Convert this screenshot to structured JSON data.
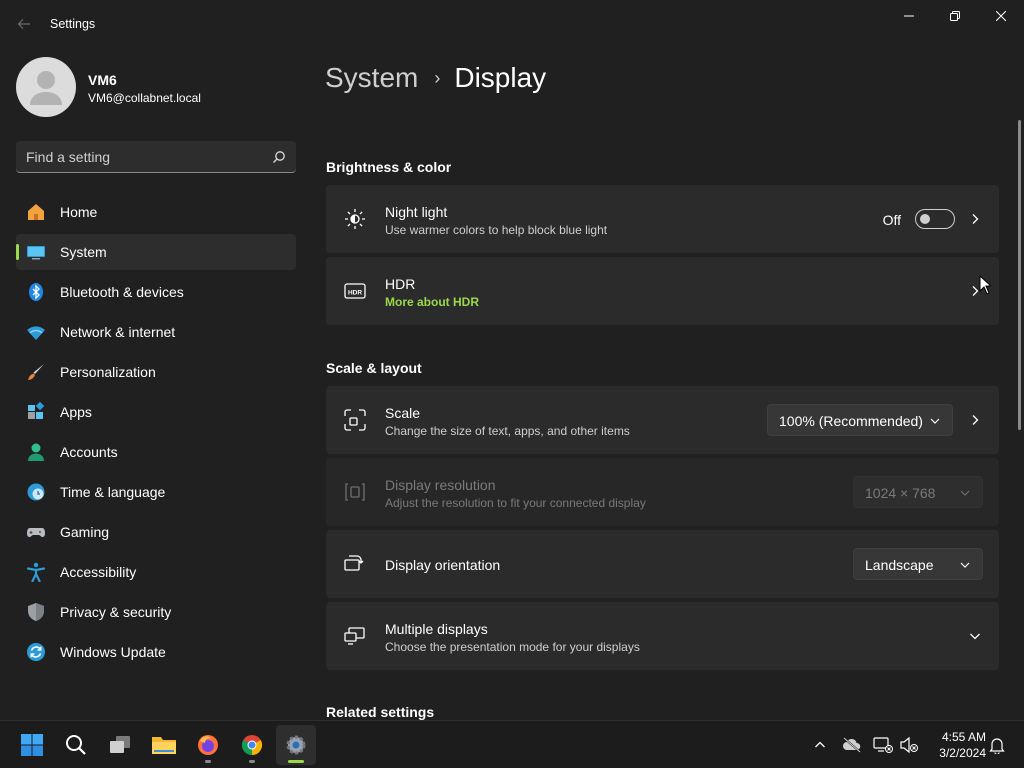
{
  "window": {
    "title": "Settings"
  },
  "profile": {
    "name": "VM6",
    "email": "VM6@collabnet.local"
  },
  "search": {
    "placeholder": "Find a setting"
  },
  "nav": {
    "items": [
      {
        "label": "Home",
        "icon": "home-icon"
      },
      {
        "label": "System",
        "icon": "system-icon",
        "active": true
      },
      {
        "label": "Bluetooth & devices",
        "icon": "bluetooth-icon"
      },
      {
        "label": "Network & internet",
        "icon": "wifi-icon"
      },
      {
        "label": "Personalization",
        "icon": "brush-icon"
      },
      {
        "label": "Apps",
        "icon": "apps-icon"
      },
      {
        "label": "Accounts",
        "icon": "person-icon"
      },
      {
        "label": "Time & language",
        "icon": "clock-globe-icon"
      },
      {
        "label": "Gaming",
        "icon": "gamepad-icon"
      },
      {
        "label": "Accessibility",
        "icon": "accessibility-icon"
      },
      {
        "label": "Privacy & security",
        "icon": "shield-icon"
      },
      {
        "label": "Windows Update",
        "icon": "update-icon"
      }
    ]
  },
  "breadcrumb": {
    "parent": "System",
    "separator": "›",
    "current": "Display"
  },
  "sections": {
    "brightness": "Brightness & color",
    "scale_layout": "Scale & layout",
    "related": "Related settings"
  },
  "night_light": {
    "title": "Night light",
    "subtitle": "Use warmer colors to help block blue light",
    "state": "Off",
    "on": false
  },
  "hdr": {
    "title": "HDR",
    "link": "More about HDR"
  },
  "scale": {
    "title": "Scale",
    "subtitle": "Change the size of text, apps, and other items",
    "value": "100% (Recommended)"
  },
  "resolution": {
    "title": "Display resolution",
    "subtitle": "Adjust the resolution to fit your connected display",
    "value": "1024 × 768",
    "disabled": true
  },
  "orientation": {
    "title": "Display orientation",
    "value": "Landscape"
  },
  "multiple": {
    "title": "Multiple displays",
    "subtitle": "Choose the presentation mode for your displays"
  },
  "taskbar": {
    "apps": [
      "start-icon",
      "search-icon",
      "task-view-icon",
      "file-explorer-icon",
      "firefox-icon",
      "chrome-icon",
      "settings-icon"
    ],
    "time": "4:55 AM",
    "date": "3/2/2024"
  },
  "colors": {
    "accent": "#9bd94a",
    "background": "#202020",
    "card": "#2b2b2b"
  }
}
